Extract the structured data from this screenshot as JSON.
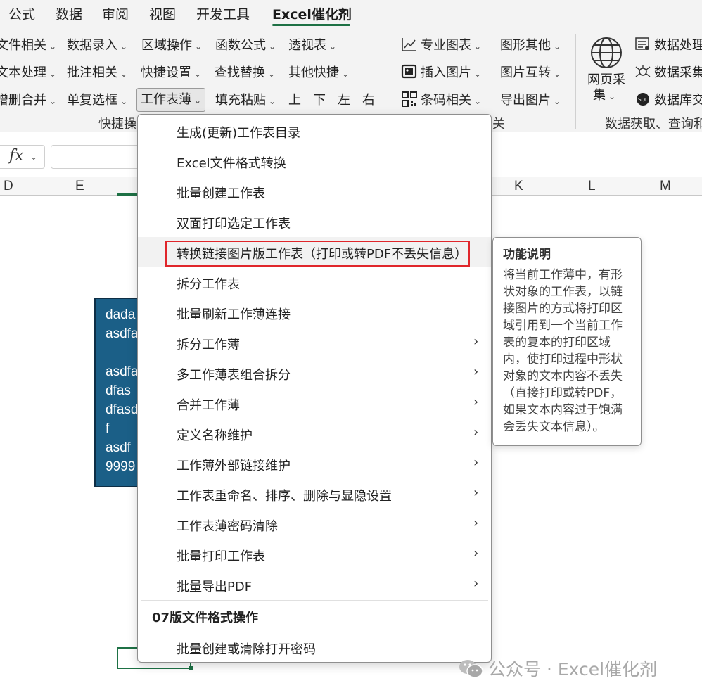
{
  "tabs": [
    "公式",
    "数据",
    "审阅",
    "视图",
    "开发工具",
    "Excel催化剂"
  ],
  "active_tab": "Excel催化剂",
  "ribbon": {
    "row1": [
      "文件相关",
      "数据录入",
      "区域操作",
      "函数公式",
      "透视表",
      "专业图表",
      "图形其他",
      "数据处理"
    ],
    "row2": [
      "文本处理",
      "批注相关",
      "快捷设置",
      "查找替换",
      "其他快捷",
      "插入图片",
      "图片互转",
      "数据采集"
    ],
    "row3": [
      "增删合并",
      "单复选框",
      "工作表薄",
      "填充粘贴",
      "上",
      "下",
      "左",
      "右",
      "条码相关",
      "导出图片",
      "数据库交"
    ],
    "web_collect_line1": "网页采",
    "web_collect_line2": "集",
    "group_labels": [
      "快捷操",
      "关",
      "数据获取、查询和"
    ]
  },
  "formula_bar": {
    "fx": "fx",
    "value": ""
  },
  "columns": [
    "D",
    "E",
    "K",
    "L",
    "M"
  ],
  "shape_text": [
    "dada",
    "asdfa",
    "",
    "asdfa",
    "dfas",
    "dfasd",
    "f",
    "asdf",
    "9999"
  ],
  "menu": {
    "items": [
      {
        "label": "生成(更新)工作表目录",
        "submenu": false
      },
      {
        "label": "Excel文件格式转换",
        "submenu": false
      },
      {
        "label": "批量创建工作表",
        "submenu": false
      },
      {
        "label": "双面打印选定工作表",
        "submenu": false
      },
      {
        "label": "转换链接图片版工作表（打印或转PDF不丢失信息）",
        "submenu": false,
        "highlighted": true
      },
      {
        "label": "拆分工作表",
        "submenu": false
      },
      {
        "label": "批量刷新工作薄连接",
        "submenu": false
      },
      {
        "label": "拆分工作薄",
        "submenu": true
      },
      {
        "label": "多工作薄表组合拆分",
        "submenu": true
      },
      {
        "label": "合并工作薄",
        "submenu": true
      },
      {
        "label": "定义名称维护",
        "submenu": true
      },
      {
        "label": "工作薄外部链接维护",
        "submenu": true
      },
      {
        "label": "工作表重命名、排序、删除与显隐设置",
        "submenu": true
      },
      {
        "label": "工作表薄密码清除",
        "submenu": true
      },
      {
        "label": "批量打印工作表",
        "submenu": true
      },
      {
        "label": "批量导出PDF",
        "submenu": true
      }
    ],
    "section_header": "07版文件格式操作",
    "section_items": [
      {
        "label": "批量创建或清除打开密码",
        "submenu": false
      }
    ]
  },
  "tooltip": {
    "title": "功能说明",
    "lines": [
      "将当前工作薄中，有形",
      "状对象的工作表，以链",
      "接图片的方式将打印区",
      "域引用到一个当前工作",
      "表的复本的打印区域",
      "内，使打印过程中形状",
      "对象的文本内容不丢失",
      "（直接打印或转PDF，",
      "如果文本内容过于饱满",
      "会丢失文本信息）。"
    ]
  },
  "watermark": "公众号 · Excel催化剂",
  "colors": {
    "accent_green": "#1e7145",
    "shape_fill": "#1b5f87",
    "highlight_red": "#e0262b"
  }
}
